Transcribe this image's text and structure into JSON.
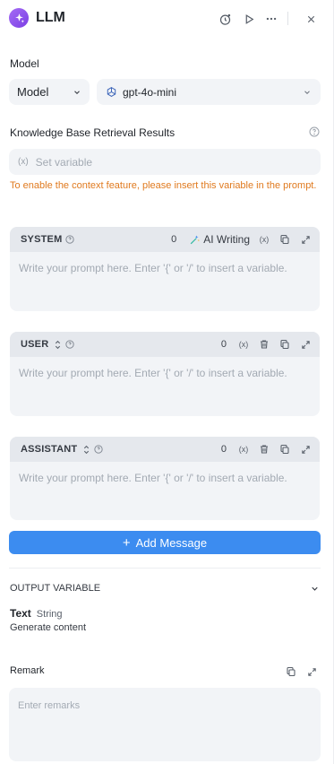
{
  "header": {
    "title": "LLM"
  },
  "model": {
    "section_label": "Model",
    "type_select": "Model",
    "model_name": "gpt-4o-mini"
  },
  "knowledge": {
    "label": "Knowledge Base Retrieval Results",
    "var_icon": "(x)",
    "placeholder": "Set variable",
    "warning": "To enable the context feature, please insert this variable in the prompt."
  },
  "prompts": {
    "system": {
      "role": "SYSTEM",
      "count": "0",
      "ai_writing": "AI Writing",
      "var_icon": "(x)",
      "placeholder": "Write your prompt here. Enter '{' or '/' to insert a variable."
    },
    "user": {
      "role": "USER",
      "count": "0",
      "var_icon": "(x)",
      "placeholder": "Write your prompt here. Enter '{' or '/' to insert a variable."
    },
    "assistant": {
      "role": "ASSISTANT",
      "count": "0",
      "var_icon": "(x)",
      "placeholder": "Write your prompt here. Enter '{' or '/' to insert a variable."
    }
  },
  "add_message": {
    "plus": "+",
    "label": "Add Message"
  },
  "output": {
    "section_label": "OUTPUT VARIABLE",
    "var_name": "Text",
    "var_type": "String",
    "var_desc": "Generate content"
  },
  "remark": {
    "label": "Remark",
    "placeholder": "Enter remarks"
  },
  "colors": {
    "accent": "#3c8cf0",
    "warning": "#e07a1f",
    "logo": "#8b5cf6"
  }
}
